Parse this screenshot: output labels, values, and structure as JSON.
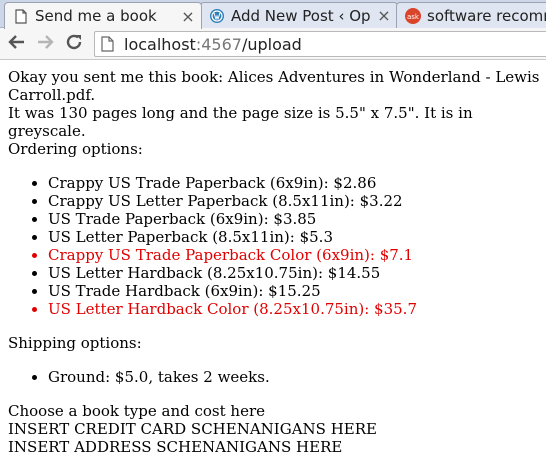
{
  "browser": {
    "tabs": [
      {
        "title": "Send me a book",
        "active": true
      },
      {
        "title": "Add New Post ‹ Op",
        "active": false
      },
      {
        "title": "software recomm",
        "active": false
      }
    ],
    "close_glyph": "×",
    "url": {
      "host": "localhost",
      "port": ":4567",
      "path": "/upload"
    }
  },
  "page": {
    "line1": "Okay you sent me this book: Alices Adventures in Wonderland - Lewis Carroll.pdf.",
    "line2": "It was 130 pages long and the page size is 5.5\" x 7.5\". It is in greyscale.",
    "ordering_heading": "Ordering options:",
    "ordering_options": [
      {
        "text": "Crappy US Trade Paperback (6x9in): $2.86",
        "color": "#000000"
      },
      {
        "text": "Crappy US Letter Paperback (8.5x11in): $3.22",
        "color": "#000000"
      },
      {
        "text": "US Trade Paperback (6x9in): $3.85",
        "color": "#000000"
      },
      {
        "text": "US Letter Paperback (8.5x11in): $5.3",
        "color": "#000000"
      },
      {
        "text": "Crappy US Trade Paperback Color (6x9in): $7.1",
        "color": "#e00000"
      },
      {
        "text": "US Letter Hardback (8.25x10.75in): $14.55",
        "color": "#000000"
      },
      {
        "text": "US Trade Hardback (6x9in): $15.25",
        "color": "#000000"
      },
      {
        "text": "US Letter Hardback Color (8.25x10.75in): $35.7",
        "color": "#e00000"
      }
    ],
    "shipping_heading": "Shipping options:",
    "shipping_options": [
      {
        "text": "Ground: $5.0, takes 2 weeks."
      }
    ],
    "footer_lines": [
      "Choose a book type and cost here",
      "INSERT CREDIT CARD SCHENANIGANS HERE",
      "INSERT ADDRESS SCHENANIGANS HERE"
    ]
  },
  "colors": {
    "accent_red": "#e00000",
    "ask_icon": "#d9442b"
  },
  "icons": [
    "document-icon",
    "wordpress-icon",
    "ask-icon",
    "back-arrow-icon",
    "forward-arrow-icon",
    "reload-icon",
    "page-icon"
  ]
}
